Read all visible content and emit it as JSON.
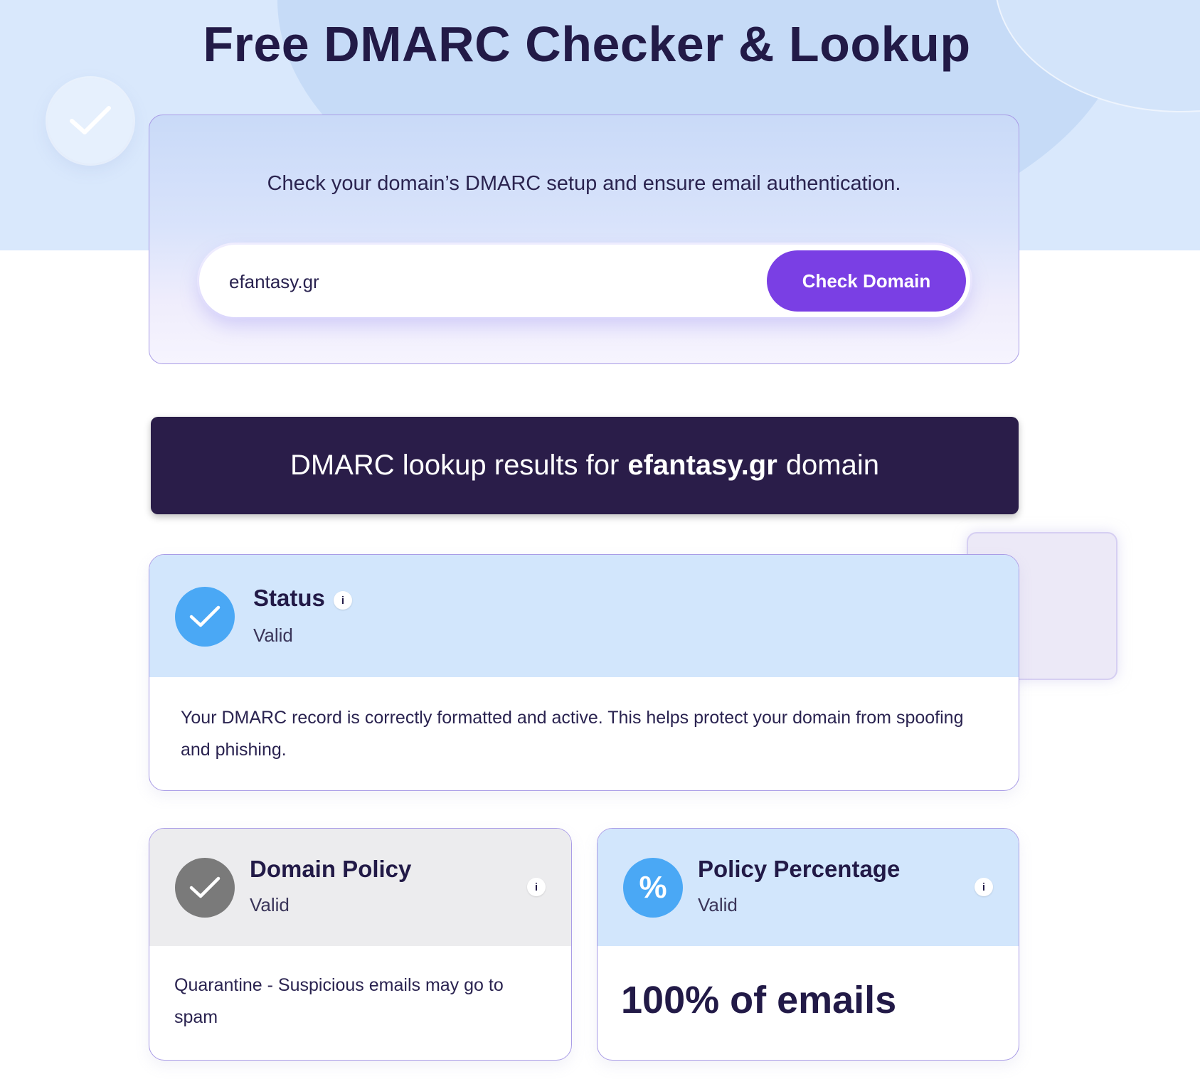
{
  "page": {
    "title": "Free DMARC Checker & Lookup",
    "subtitle": "Check your domain’s DMARC setup and ensure email authentication."
  },
  "search": {
    "value": "efantasy.gr",
    "button_label": "Check Domain"
  },
  "results": {
    "prefix": "DMARC lookup results for",
    "domain": "efantasy.gr",
    "suffix": "domain"
  },
  "status_card": {
    "title": "Status",
    "value": "Valid",
    "info": "i",
    "description": "Your DMARC record is correctly formatted and active. This helps protect your domain from spoofing and phishing.",
    "icon": "check-circle-icon"
  },
  "policy_card": {
    "title": "Domain Policy",
    "value": "Valid",
    "info": "i",
    "description": "Quarantine - Suspicious emails may go to spam",
    "icon": "check-circle-icon"
  },
  "percentage_card": {
    "title": "Policy Percentage",
    "value": "Valid",
    "info": "i",
    "icon_glyph": "%",
    "big_value": "100% of emails",
    "icon": "percent-icon"
  },
  "colors": {
    "accent": "#7a3fe4",
    "banner": "#2a1d49",
    "status_blue": "#4aa8f5",
    "policy_gray": "#7a7a7a",
    "head_blue": "#d2e6fc"
  }
}
